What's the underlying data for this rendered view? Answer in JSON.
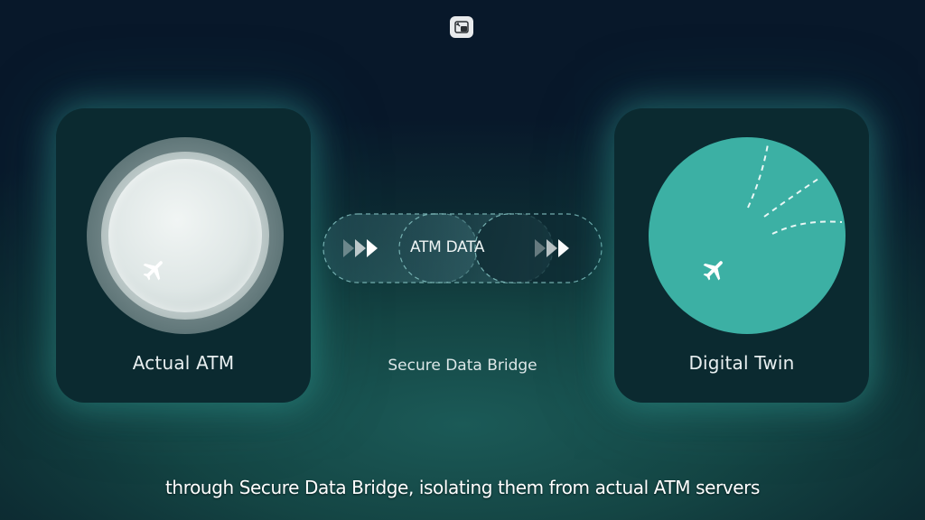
{
  "controls": {
    "pip_icon": "picture-in-picture-icon"
  },
  "cards": {
    "actual": {
      "label": "Actual ATM",
      "icon": "airplane-icon"
    },
    "twin": {
      "label": "Digital Twin",
      "icon": "airplane-icon",
      "disc_color": "#3cb0a4"
    }
  },
  "bridge": {
    "data_label": "ATM DATA",
    "caption": "Secure Data Bridge",
    "icons": [
      "fast-forward-arrows-icon",
      "fast-forward-arrows-icon"
    ]
  },
  "subtitle": "through Secure Data Bridge, isolating them from actual ATM servers"
}
